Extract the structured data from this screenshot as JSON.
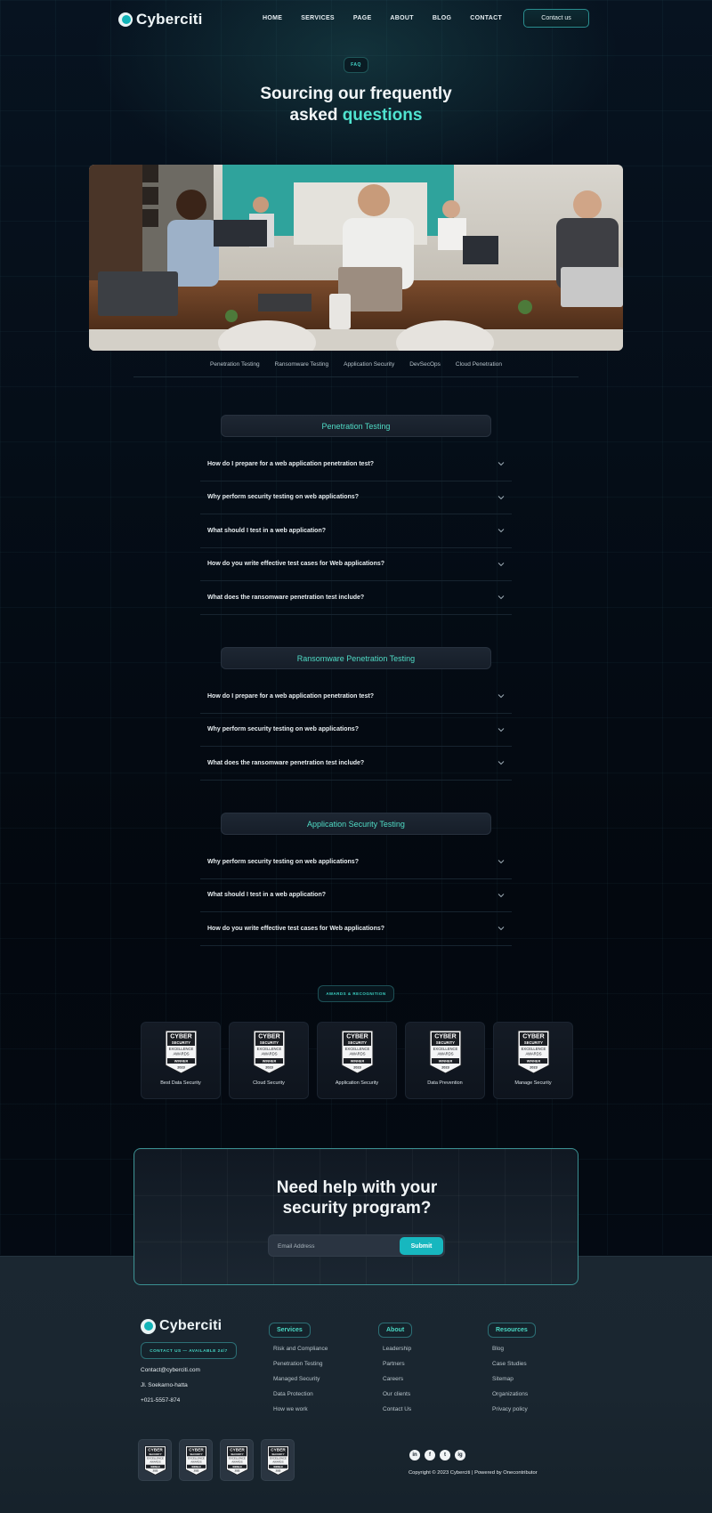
{
  "brand": {
    "name": "Cyberciti"
  },
  "nav": {
    "items": [
      "HOME",
      "SERVICES",
      "PAGE",
      "ABOUT",
      "BLOG",
      "CONTACT"
    ],
    "contact_label": "Contact us"
  },
  "hero": {
    "badge": "FAQ",
    "title_line1": "Sourcing our frequently",
    "title_line2_plain": "asked ",
    "title_line2_accent": "questions"
  },
  "tabs": [
    "Penetration Testing",
    "Ransomware Testing",
    "Application Security",
    "DevSecOps",
    "Cloud Penetration"
  ],
  "sections": [
    {
      "title": "Penetration Testing",
      "questions": [
        "How do I prepare for a web application penetration test?",
        "Why perform security testing on web applications?",
        "What should I test in a web application?",
        "How do you write effective test cases for Web applications?",
        "What does the ransomware penetration test include?"
      ]
    },
    {
      "title": "Ransomware Penetration Testing",
      "questions": [
        "How do I prepare for a web application penetration test?",
        "Why perform security testing on web applications?",
        "What does the ransomware penetration test include?"
      ]
    },
    {
      "title": "Application Security Testing",
      "questions": [
        "Why perform security testing on web applications?",
        "What should I test in a web application?",
        "How do you write effective test cases for Web applications?"
      ]
    }
  ],
  "awards": {
    "badge": "AWARDS & RECOGNITION",
    "shield": {
      "line1": "CYBER",
      "line2": "SECURITY",
      "line3": "EXCELLENCE",
      "line4": "AWARDS",
      "line5": "WINNER",
      "year": "2023"
    },
    "items": [
      "Best Data Security",
      "Cloud Security",
      "Application Security",
      "Data Prevention",
      "Manage Security"
    ]
  },
  "cta": {
    "title_line1": "Need help with your",
    "title_line2": "security program?",
    "email_placeholder": "Email Address",
    "submit_label": "Submit"
  },
  "footer": {
    "contact_pill": "CONTACT US — AVAILABLE 24/7",
    "email": "Contact@cyberciti.com",
    "address": "Jl. Soekarno-hatta",
    "phone": "+021-5557-874",
    "columns": [
      {
        "title": "Services",
        "links": [
          "Risk and Compliance",
          "Penetration Testing",
          "Managed Security",
          "Data Protection",
          "How we work"
        ]
      },
      {
        "title": "About",
        "links": [
          "Leadership",
          "Partners",
          "Careers",
          "Our clients",
          "Contact Us"
        ]
      },
      {
        "title": "Resources",
        "links": [
          "Blog",
          "Case Studies",
          "Sitemap",
          "Organizations",
          "Privacy policy"
        ]
      }
    ],
    "social": [
      "in",
      "f",
      "t",
      "ig"
    ],
    "copyright": "Copyright © 2023 Cyberciti | Powered by Onecontributor"
  },
  "colors": {
    "accent": "#4fe3cf",
    "button": "#17b7bf",
    "background": "#050c16"
  }
}
